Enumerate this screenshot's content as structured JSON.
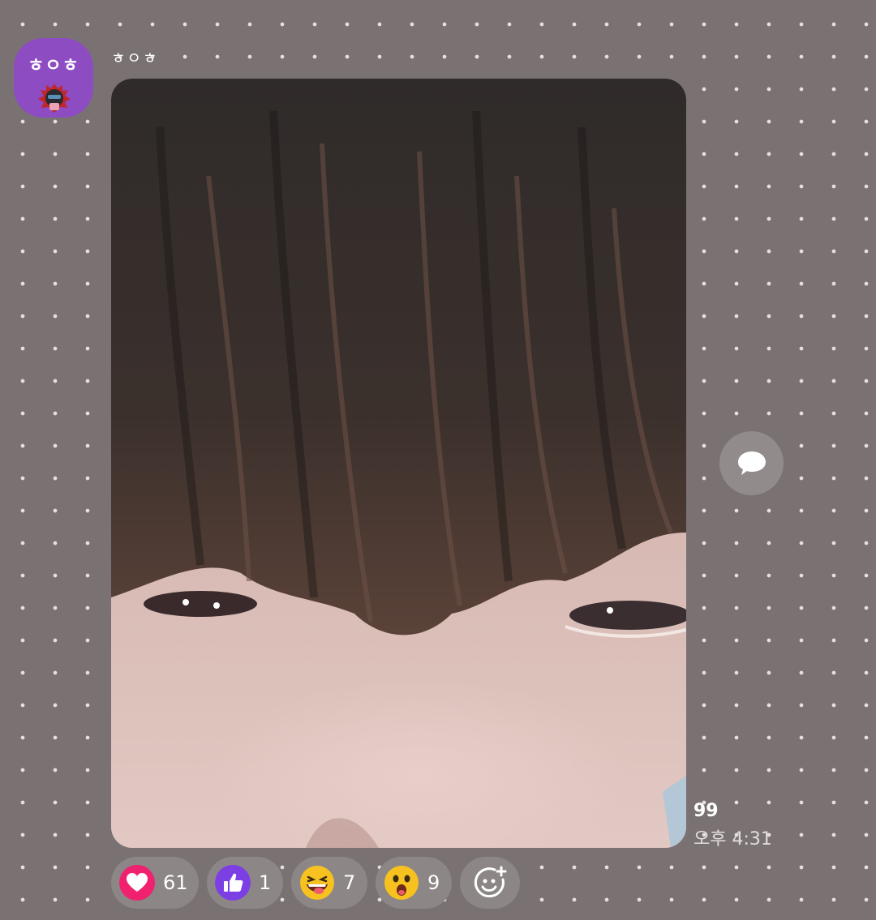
{
  "message": {
    "sender": {
      "name": "ㅎㅇㅎ",
      "avatar_text": "ㅎㅇㅎ"
    },
    "read_count": "99",
    "timestamp": "오후 4:31"
  },
  "reactions": [
    {
      "icon": "heart-icon",
      "count": "61",
      "color": "#f0216e"
    },
    {
      "icon": "thumbs-up-icon",
      "count": "1",
      "color": "#7b3fe4"
    },
    {
      "icon": "grinning-tongue-emoji-icon",
      "count": "7",
      "color": "#f7c21f"
    },
    {
      "icon": "surprised-emoji-icon",
      "count": "9",
      "color": "#f7c21f"
    }
  ],
  "colors": {
    "background": "#7a7272",
    "avatar": "#8d4cc2",
    "chip": "#8d8686"
  }
}
